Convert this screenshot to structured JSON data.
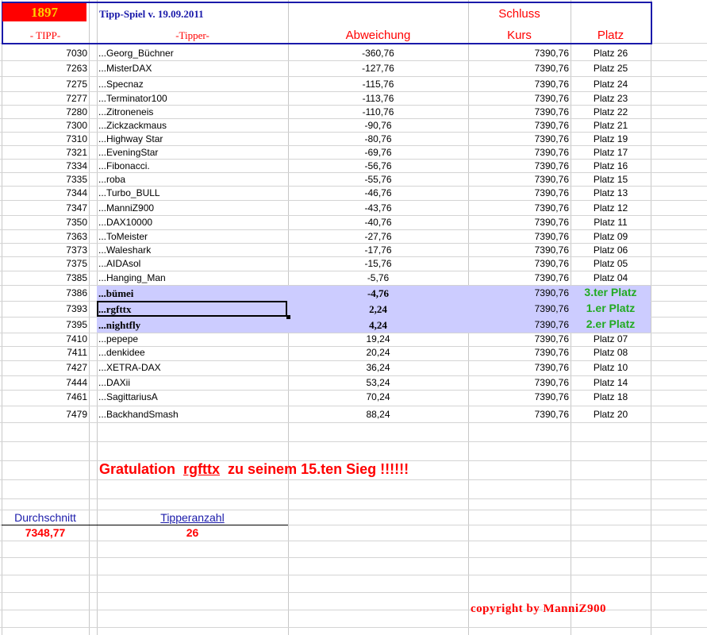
{
  "header": {
    "year": "1897",
    "title": "Tipp-Spiel v. 19.09.2011",
    "schluss": "Schluss",
    "col_tipp": "- TIPP-",
    "col_tipper": "-Tipper-",
    "col_abweichung": "Abweichung",
    "col_kurs": "Kurs",
    "col_platz": "Platz"
  },
  "rows": [
    {
      "tipp": "7030",
      "tipper": "...Georg_Büchner",
      "abw": "-360,76",
      "kurs": "7390,76",
      "platz": "Platz 26"
    },
    {
      "tipp": "7263",
      "tipper": "...MisterDAX",
      "abw": "-127,76",
      "kurs": "7390,76",
      "platz": "Platz 25"
    },
    {
      "tipp": "7275",
      "tipper": "...Specnaz",
      "abw": "-115,76",
      "kurs": "7390,76",
      "platz": "Platz 24"
    },
    {
      "tipp": "7277",
      "tipper": "...Terminator100",
      "abw": "-113,76",
      "kurs": "7390,76",
      "platz": "Platz 23"
    },
    {
      "tipp": "7280",
      "tipper": "...Zitroneneis",
      "abw": "-110,76",
      "kurs": "7390,76",
      "platz": "Platz 22"
    },
    {
      "tipp": "7300",
      "tipper": "...Zickzackmaus",
      "abw": "-90,76",
      "kurs": "7390,76",
      "platz": "Platz 21"
    },
    {
      "tipp": "7310",
      "tipper": "...Highway Star",
      "abw": "-80,76",
      "kurs": "7390,76",
      "platz": "Platz 19"
    },
    {
      "tipp": "7321",
      "tipper": "...EveningStar",
      "abw": "-69,76",
      "kurs": "7390,76",
      "platz": "Platz 17"
    },
    {
      "tipp": "7334",
      "tipper": "...Fibonacci.",
      "abw": "-56,76",
      "kurs": "7390,76",
      "platz": "Platz 16"
    },
    {
      "tipp": "7335",
      "tipper": "...roba",
      "abw": "-55,76",
      "kurs": "7390,76",
      "platz": "Platz 15"
    },
    {
      "tipp": "7344",
      "tipper": "...Turbo_BULL",
      "abw": "-46,76",
      "kurs": "7390,76",
      "platz": "Platz 13"
    },
    {
      "tipp": "7347",
      "tipper": "...ManniZ900",
      "abw": "-43,76",
      "kurs": "7390,76",
      "platz": "Platz 12"
    },
    {
      "tipp": "7350",
      "tipper": "...DAX10000",
      "abw": "-40,76",
      "kurs": "7390,76",
      "platz": "Platz 11"
    },
    {
      "tipp": "7363",
      "tipper": "...ToMeister",
      "abw": "-27,76",
      "kurs": "7390,76",
      "platz": "Platz 09"
    },
    {
      "tipp": "7373",
      "tipper": "...Waleshark",
      "abw": "-17,76",
      "kurs": "7390,76",
      "platz": "Platz 06"
    },
    {
      "tipp": "7375",
      "tipper": "...AIDAsol",
      "abw": "-15,76",
      "kurs": "7390,76",
      "platz": "Platz 05"
    },
    {
      "tipp": "7385",
      "tipper": "...Hanging_Man",
      "abw": "-5,76",
      "kurs": "7390,76",
      "platz": "Platz 04"
    },
    {
      "tipp": "7386",
      "tipper": "...bümei",
      "abw": "-4,76",
      "kurs": "7390,76",
      "platz": "3.ter Platz"
    },
    {
      "tipp": "7393",
      "tipper": "...rgfttx",
      "abw": "2,24",
      "kurs": "7390,76",
      "platz": "1.er Platz"
    },
    {
      "tipp": "7395",
      "tipper": "...nightfly",
      "abw": "4,24",
      "kurs": "7390,76",
      "platz": "2.er Platz"
    },
    {
      "tipp": "7410",
      "tipper": "...pepepe",
      "abw": "19,24",
      "kurs": "7390,76",
      "platz": "Platz 07"
    },
    {
      "tipp": "7411",
      "tipper": "...denkidee",
      "abw": "20,24",
      "kurs": "7390,76",
      "platz": "Platz 08"
    },
    {
      "tipp": "7427",
      "tipper": "...XETRA-DAX",
      "abw": "36,24",
      "kurs": "7390,76",
      "platz": "Platz 10"
    },
    {
      "tipp": "7444",
      "tipper": "...DAXii",
      "abw": "53,24",
      "kurs": "7390,76",
      "platz": "Platz 14"
    },
    {
      "tipp": "7461",
      "tipper": "...SagittariusA",
      "abw": "70,24",
      "kurs": "7390,76",
      "platz": "Platz 18"
    },
    {
      "tipp": "7479",
      "tipper": "...BackhandSmash",
      "abw": "88,24",
      "kurs": "7390,76",
      "platz": "Platz 20"
    }
  ],
  "congrats": {
    "prefix": "Gratulation",
    "name": "rgfttx",
    "suffix": "zu seinem 15.ten Sieg !!!!!!"
  },
  "stats": {
    "avg_label": "Durchschnitt",
    "avg_value": "7348,77",
    "count_label": "Tipperanzahl",
    "count_value": "26"
  },
  "copyright": "copyright by ManniZ900",
  "colors": {
    "red": "#ff0000",
    "blue": "#1a1aaa",
    "green": "#22aa22",
    "highlight": "#ccccff",
    "gold": "#ffd000"
  }
}
